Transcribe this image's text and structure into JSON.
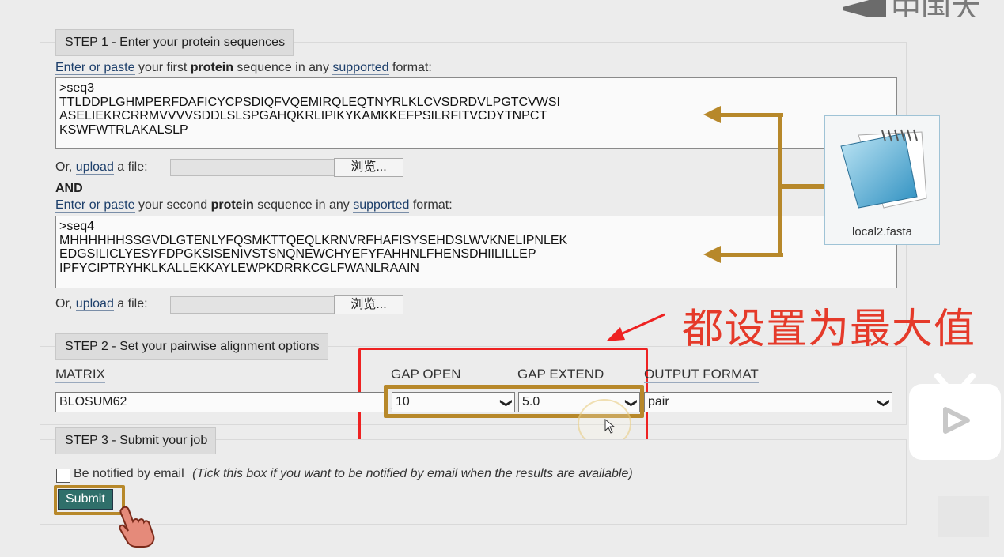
{
  "watermark": {
    "text": "中国大学"
  },
  "step1": {
    "label": "STEP 1 - Enter your protein sequences",
    "first_intro": {
      "link1": "Enter or paste",
      "t1": "your first",
      "bold": "protein",
      "t2": "sequence in any",
      "link2": "supported",
      "t3": "format:"
    },
    "seq1": ">seq3\nTTLDDPLGHMPERFDAFICYCPSDIQFVQEMIRQLEQTNYRLKLCVSDRDVLPGTCVWSI\nASELIEKRCRRMVVVVSDDLSLSPGAHQKRLIPIKYKAMKKEFPSILRFITVCDYTNPCT\nKSWFWTRLAKALSLP",
    "upload1": {
      "t1": "Or,",
      "link": "upload",
      "t2": "a file:",
      "browse": "浏览..."
    },
    "and": "AND",
    "second_intro": {
      "link1": "Enter or paste",
      "t1": "your second",
      "bold": "protein",
      "t2": "sequence in any",
      "link2": "supported",
      "t3": "format:"
    },
    "seq2": ">seq4\nMHHHHHHSSGVDLGTENLYFQSMKTTQEQLKRNVRFHAFISYSEHDSLWVKNELIPNLEK\nEDGSILICLYESYFDPGKSISENIVSTSNQNEWCHYEFYFAHHNLFHENSDHIILILLEP\nIPFYCIPTRYHKLKALLEKKAYLEWPKDRRKCGLFWANLRAAIN",
    "upload2": {
      "t1": "Or,",
      "link": "upload",
      "t2": "a file:",
      "browse": "浏览..."
    }
  },
  "file_icon": {
    "name": "local2.fasta",
    "icon": "notepad-file-icon"
  },
  "annotation": {
    "text": "都设置为最大值",
    "color": "#e53a2a"
  },
  "step2": {
    "label": "STEP 2 - Set your pairwise alignment options",
    "matrix": {
      "header": "MATRIX",
      "value": "BLOSUM62"
    },
    "gap_open": {
      "header": "GAP OPEN",
      "value": "10"
    },
    "gap_extend": {
      "header": "GAP EXTEND",
      "value": "5.0"
    },
    "output_format": {
      "header": "OUTPUT FORMAT",
      "value": "pair"
    }
  },
  "step3": {
    "label": "STEP 3 - Submit your job",
    "notify_label": "Be notified by email",
    "notify_hint": "(Tick this box if you want to be notified by email when the results are available)",
    "submit": "Submit"
  },
  "colors": {
    "highlight": "#b7882a",
    "annotation_red": "#e22222",
    "submit_bg": "#2f6f6a"
  }
}
